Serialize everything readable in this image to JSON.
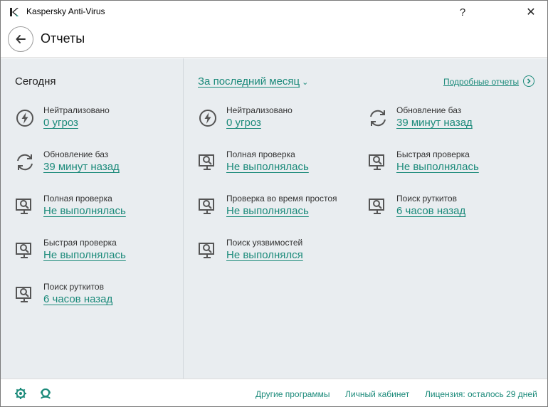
{
  "window": {
    "title": "Kaspersky Anti-Virus",
    "help_label": "?",
    "close_label": "✕",
    "accent": "#1b8a7a"
  },
  "header": {
    "title": "Отчеты"
  },
  "today": {
    "title": "Сегодня",
    "items": [
      {
        "icon": "lightning-icon",
        "label": "Нейтрализовано",
        "value": "0 угроз"
      },
      {
        "icon": "refresh-icon",
        "label": "Обновление баз",
        "value": "39 минут назад"
      },
      {
        "icon": "monitor-search-icon",
        "label": "Полная проверка",
        "value": "Не выполнялась"
      },
      {
        "icon": "monitor-search-icon",
        "label": "Быстрая проверка",
        "value": "Не выполнялась"
      },
      {
        "icon": "monitor-search-icon",
        "label": "Поиск руткитов",
        "value": "6 часов назад"
      }
    ]
  },
  "month": {
    "period_label": "За последний месяц",
    "detailed_reports": "Подробные отчеты",
    "left_items": [
      {
        "icon": "lightning-icon",
        "label": "Нейтрализовано",
        "value": "0 угроз"
      },
      {
        "icon": "monitor-search-icon",
        "label": "Полная проверка",
        "value": "Не выполнялась"
      },
      {
        "icon": "monitor-search-icon",
        "label": "Проверка во время простоя",
        "value": "Не выполнялась"
      },
      {
        "icon": "monitor-search-icon",
        "label": "Поиск уязвимостей",
        "value": "Не выполнялся"
      }
    ],
    "right_items": [
      {
        "icon": "refresh-icon",
        "label": "Обновление баз",
        "value": "39 минут назад"
      },
      {
        "icon": "monitor-search-icon",
        "label": "Быстрая проверка",
        "value": "Не выполнялась"
      },
      {
        "icon": "monitor-search-icon",
        "label": "Поиск руткитов",
        "value": "6 часов назад"
      }
    ]
  },
  "footer": {
    "other_programs": "Другие программы",
    "account": "Личный кабинет",
    "license": "Лицензия: осталось 29 дней"
  }
}
